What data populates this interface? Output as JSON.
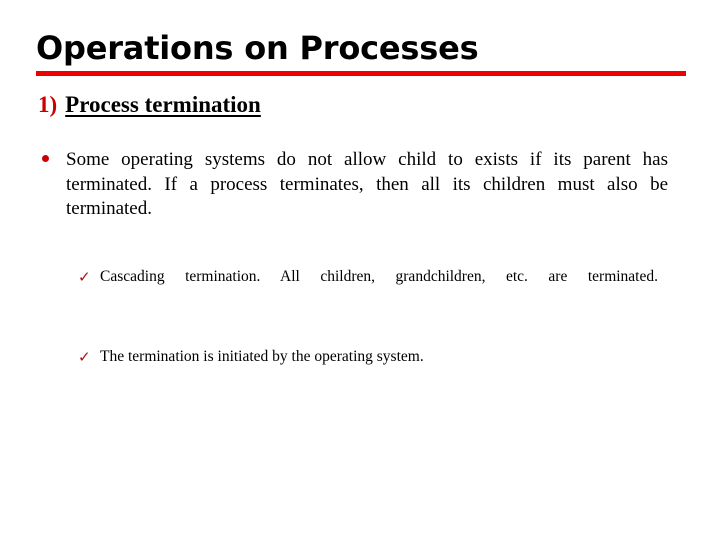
{
  "slide": {
    "title": "Operations on Processes",
    "accent_color": "#ee0000",
    "background_color": "#ffffff",
    "text_color": "#000000"
  },
  "section": {
    "number": "1)",
    "number_color": "#cc0000",
    "label": "Process termination"
  },
  "bullets": [
    {
      "marker": "round-bullet",
      "marker_color": "#cc0000",
      "text": "Some operating systems do not allow child to exists if its parent has terminated.  If a process terminates, then all its children must also be terminated."
    }
  ],
  "sub_bullets": [
    {
      "marker": "check-icon",
      "marker_glyph": "✓",
      "marker_color": "#a81010",
      "text": "Cascading  termination.    All  children,  grandchildren,  etc.    are terminated."
    },
    {
      "marker": "check-icon",
      "marker_glyph": "✓",
      "marker_color": "#a81010",
      "text": "The termination is initiated by the operating system."
    }
  ]
}
